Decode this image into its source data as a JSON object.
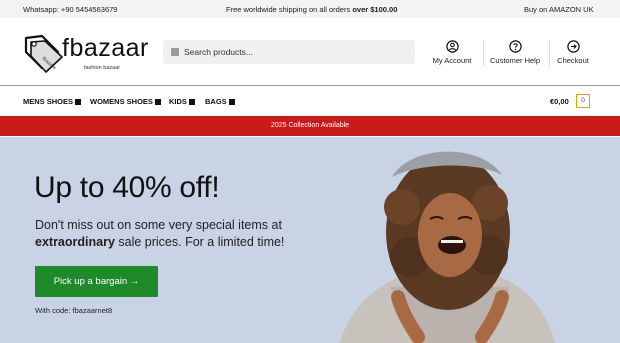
{
  "topbar": {
    "whatsapp": "Whatsapp: +90 5454563679",
    "shipping_text": "Free worldwide shipping on all orders ",
    "shipping_amount": "over $100.00",
    "amazon": "Buy on AMAZON UK"
  },
  "logo": {
    "word": "fbazaar",
    "sub": "fashion bazaar",
    "tag_text": "fbazaar"
  },
  "search": {
    "placeholder": "Search products..."
  },
  "header_nav": [
    {
      "label": "My Account",
      "icon": "user-icon"
    },
    {
      "label": "Customer Help",
      "icon": "help-icon"
    },
    {
      "label": "Checkout",
      "icon": "arrow-right-circle-icon"
    }
  ],
  "menu": [
    {
      "label": "MENS SHOES"
    },
    {
      "label": "WOMENS SHOES"
    },
    {
      "label": "KIDS"
    },
    {
      "label": "BAGS"
    }
  ],
  "cart": {
    "amount": "€0,00",
    "count": "0"
  },
  "banner": {
    "text": "2025 Collection Available",
    "color": "#cc1a1a"
  },
  "hero": {
    "title": "Up to 40% off!",
    "text_1": "Don't miss out on some very special items at ",
    "text_bold": "extraordinary",
    "text_2": " sale prices. For a limited time!",
    "button": "Pick up a bargain →",
    "code": "With code: fbazaarnet8",
    "bg_color": "#c9d3e6",
    "button_color": "#1f8a2a"
  }
}
